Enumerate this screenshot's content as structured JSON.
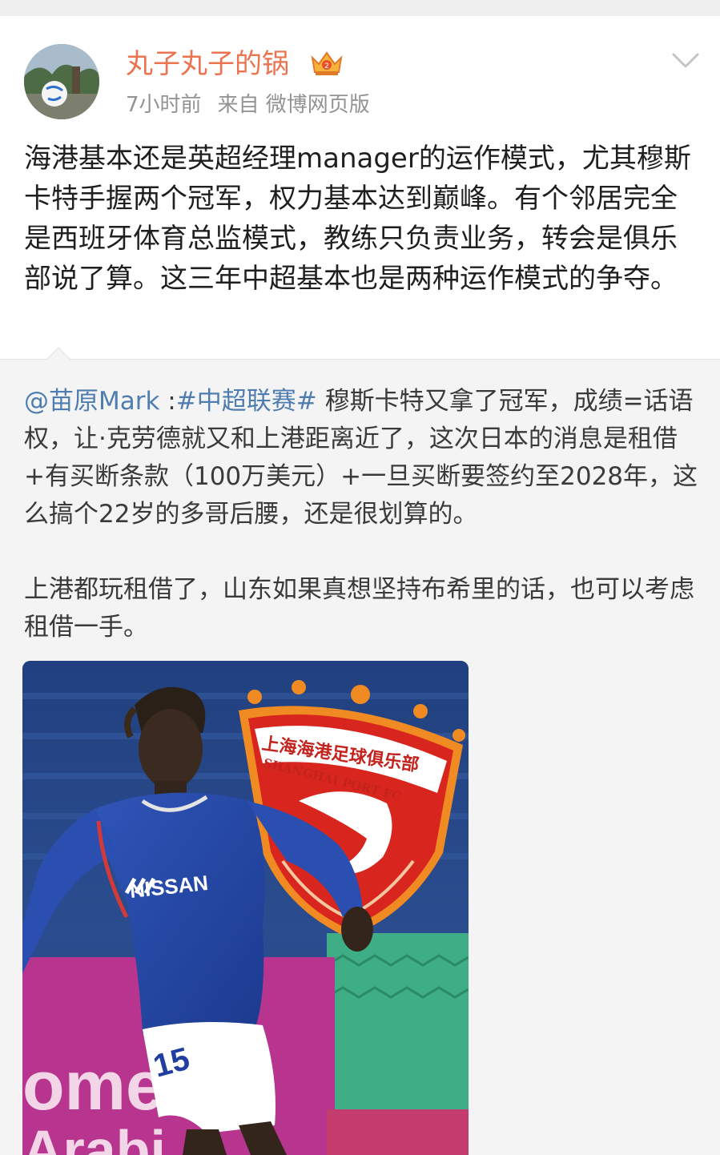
{
  "post": {
    "author": {
      "name": "丸子丸子的锅",
      "badge_icon": "vip-crown-icon"
    },
    "meta": {
      "time": "7小时前",
      "source": "来自 微博网页版"
    },
    "menu_icon": "chevron-down-icon",
    "text": "海港基本还是英超经理manager的运作模式，尤其穆斯卡特手握两个冠军，权力基本达到巅峰。有个邻居完全是西班牙体育总监模式，教练只负责业务，转会是俱乐部说了算。这三年中超基本也是两种运作模式的争夺。"
  },
  "repost": {
    "mention": "@苗原Mark",
    "separator": " :",
    "hashtag": "#中超联赛#",
    "paragraph1_rest": " 穆斯卡特又拿了冠军，成绩=话语权，让·克劳德就又和上港距离近了，这次日本的消息是租借+有买断条款（100万美元）+一旦买断要签约至2028年，这么搞个22岁的多哥后腰，还是很划算的。",
    "paragraph2": "上港都玩租借了，山东如果真想坚持布希里的话，也可以考虑租借一手。",
    "image": {
      "jersey_sponsor": "NISSAN",
      "jersey_number": "15",
      "crest_text_cn": "上海海港足球俱乐部",
      "crest_text_en": "SHANGHAI PORT FC",
      "board_text": "ome",
      "board_text_2": "Arabi"
    }
  },
  "colors": {
    "username": "#eb7350",
    "link": "#507daf",
    "meta": "#939393",
    "repost_bg": "#f4f4f4"
  }
}
